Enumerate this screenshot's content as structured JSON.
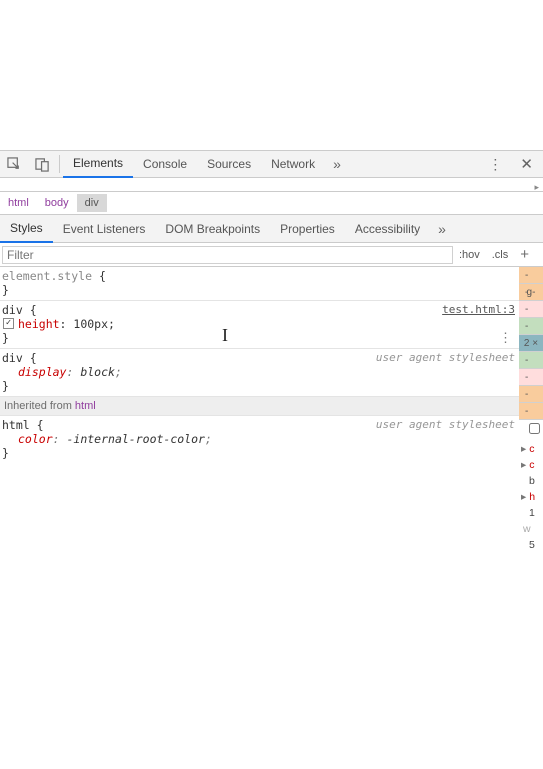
{
  "toolbar": {
    "tabs": [
      "Elements",
      "Console",
      "Sources",
      "Network"
    ],
    "activeTab": 0
  },
  "breadcrumbs": [
    "html",
    "body",
    "div"
  ],
  "breadcrumb_selected_index": 2,
  "subtabs": [
    "Styles",
    "Event Listeners",
    "DOM Breakpoints",
    "Properties",
    "Accessibility"
  ],
  "subtab_active_index": 0,
  "filter": {
    "placeholder": "Filter"
  },
  "styles_buttons": {
    "hov": ":hov",
    "cls": ".cls"
  },
  "rules": {
    "element_style": {
      "selector": "element.style",
      "props": []
    },
    "r1": {
      "selector": "div",
      "source": "test.html:3",
      "props": [
        {
          "name": "height",
          "value": "100px",
          "checked": true
        }
      ]
    },
    "r2": {
      "selector": "div",
      "ua": true,
      "props": [
        {
          "name": "display",
          "value": "block",
          "italic": true
        }
      ]
    },
    "inherited_from": "html",
    "r3": {
      "selector": "html",
      "ua": true,
      "props": [
        {
          "name": "color",
          "value": "-internal-root-color",
          "italic": true
        }
      ]
    }
  },
  "ua_label": "user agent stylesheet",
  "inherited_label": "Inherited from ",
  "side_fragments": {
    "a": "g-",
    "b": "2 ×",
    "c": "c",
    "d": "c",
    "e": "b",
    "f": "h",
    "g": "1",
    "h": "w",
    "i": "5"
  }
}
